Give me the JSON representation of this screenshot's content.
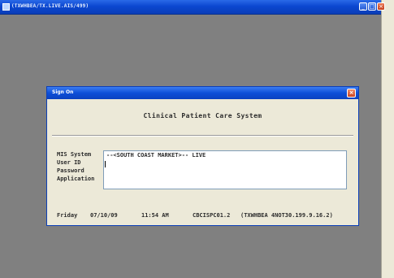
{
  "window": {
    "title": "(TXWHBEA/TX.LIVE.AIS/499)",
    "buttons": {
      "minimize": "_",
      "maximize": "□",
      "close": "×"
    }
  },
  "dialog": {
    "title": "Sign On",
    "close_label": "×",
    "heading": "Clinical Patient Care System",
    "labels": [
      "MIS System",
      "User ID",
      "Password",
      "Application"
    ],
    "system_value": "--<SOUTH COAST MARKET>-- LIVE",
    "footer": {
      "day": "Friday",
      "date": "07/10/09",
      "time": "11:54 AM",
      "station": "CBCISPC01.2",
      "connection": "(TXWHBEA 4NOT30.199.9.16.2)"
    }
  }
}
